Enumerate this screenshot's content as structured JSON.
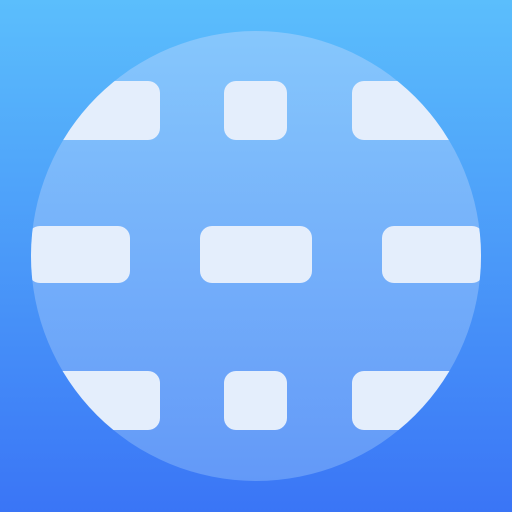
{
  "icon": {
    "name": "globe-grid-icon",
    "colors": {
      "background_top": "#5bbefc",
      "background_bottom": "#3a75f6",
      "sphere_top": "#86c7fc",
      "sphere_bottom": "#6399f8",
      "tile": "#e4eefc"
    }
  }
}
